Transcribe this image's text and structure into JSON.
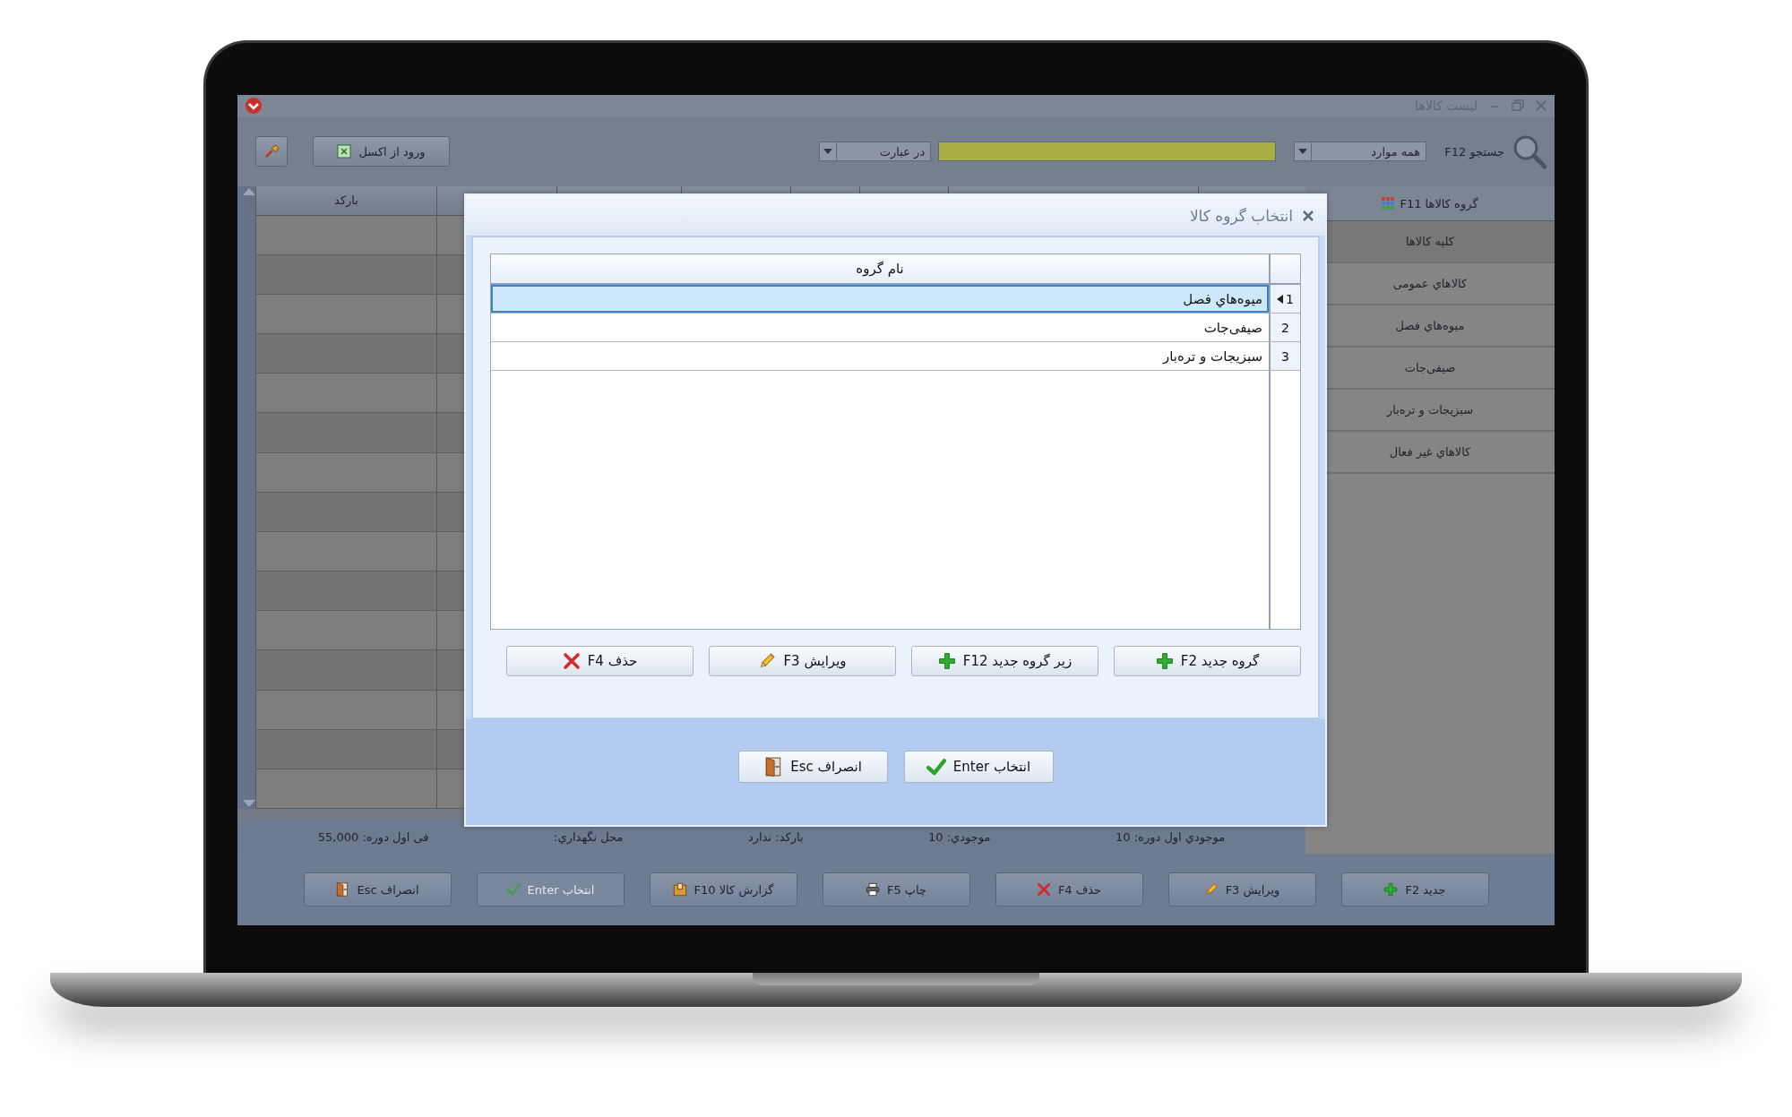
{
  "window": {
    "title": "لیست کالاها"
  },
  "toolbar": {
    "search_label": "جستجو F12",
    "scope": "همه موارد",
    "match": "در عبارت",
    "excel_button": "ورود از اکسل"
  },
  "table": {
    "columns": [
      "بارکد"
    ]
  },
  "sidebar": {
    "title": "گروه کالاها F11",
    "items": [
      {
        "label": "کلیه کالاها",
        "selected": true
      },
      {
        "label": "کالاهاي عمومی",
        "selected": false
      },
      {
        "label": "میوه‌هاي فصل",
        "selected": false
      },
      {
        "label": "صیفی‌جات",
        "selected": false
      },
      {
        "label": "سبزیجات و تره‌بار",
        "selected": false
      },
      {
        "label": "کالاهاي غیر فعال",
        "selected": false
      }
    ]
  },
  "details": [
    "موجودي اول دوره: 10",
    "موجودي: 10",
    "بارکد: ندارد",
    "محل نگهداري:",
    "فی اول دوره: 55,000"
  ],
  "actions": [
    {
      "label": "جدید F2",
      "kind": "plus",
      "disabled": false
    },
    {
      "label": "ویرایش F3",
      "kind": "pencil",
      "disabled": false
    },
    {
      "label": "حذف F4",
      "kind": "cross",
      "disabled": false
    },
    {
      "label": "چاپ F5",
      "kind": "printer",
      "disabled": false
    },
    {
      "label": "گزارش کالا F10",
      "kind": "box",
      "disabled": false
    },
    {
      "label": "انتخاب Enter",
      "kind": "check",
      "disabled": true
    },
    {
      "label": "انصراف Esc",
      "kind": "door",
      "disabled": false
    }
  ],
  "dialog": {
    "title": "انتخاب گروه کالا",
    "column": "نام گروه",
    "rows": [
      {
        "index": "1",
        "name": "میوه‌هاي فصل",
        "selected": true
      },
      {
        "index": "2",
        "name": "صیفی‌جات",
        "selected": false
      },
      {
        "index": "3",
        "name": "سبزیجات و تره‌بار",
        "selected": false
      }
    ],
    "buttons": [
      {
        "label": "گروه جدید F2",
        "kind": "plus"
      },
      {
        "label": "زیر گروه جدید F12",
        "kind": "plus"
      },
      {
        "label": "ویرایش F3",
        "kind": "pencil"
      },
      {
        "label": "حذف F4",
        "kind": "cross"
      }
    ],
    "footer_buttons": [
      {
        "label": "انتخاب Enter",
        "kind": "check"
      },
      {
        "label": "انصراف Esc",
        "kind": "door"
      }
    ]
  }
}
